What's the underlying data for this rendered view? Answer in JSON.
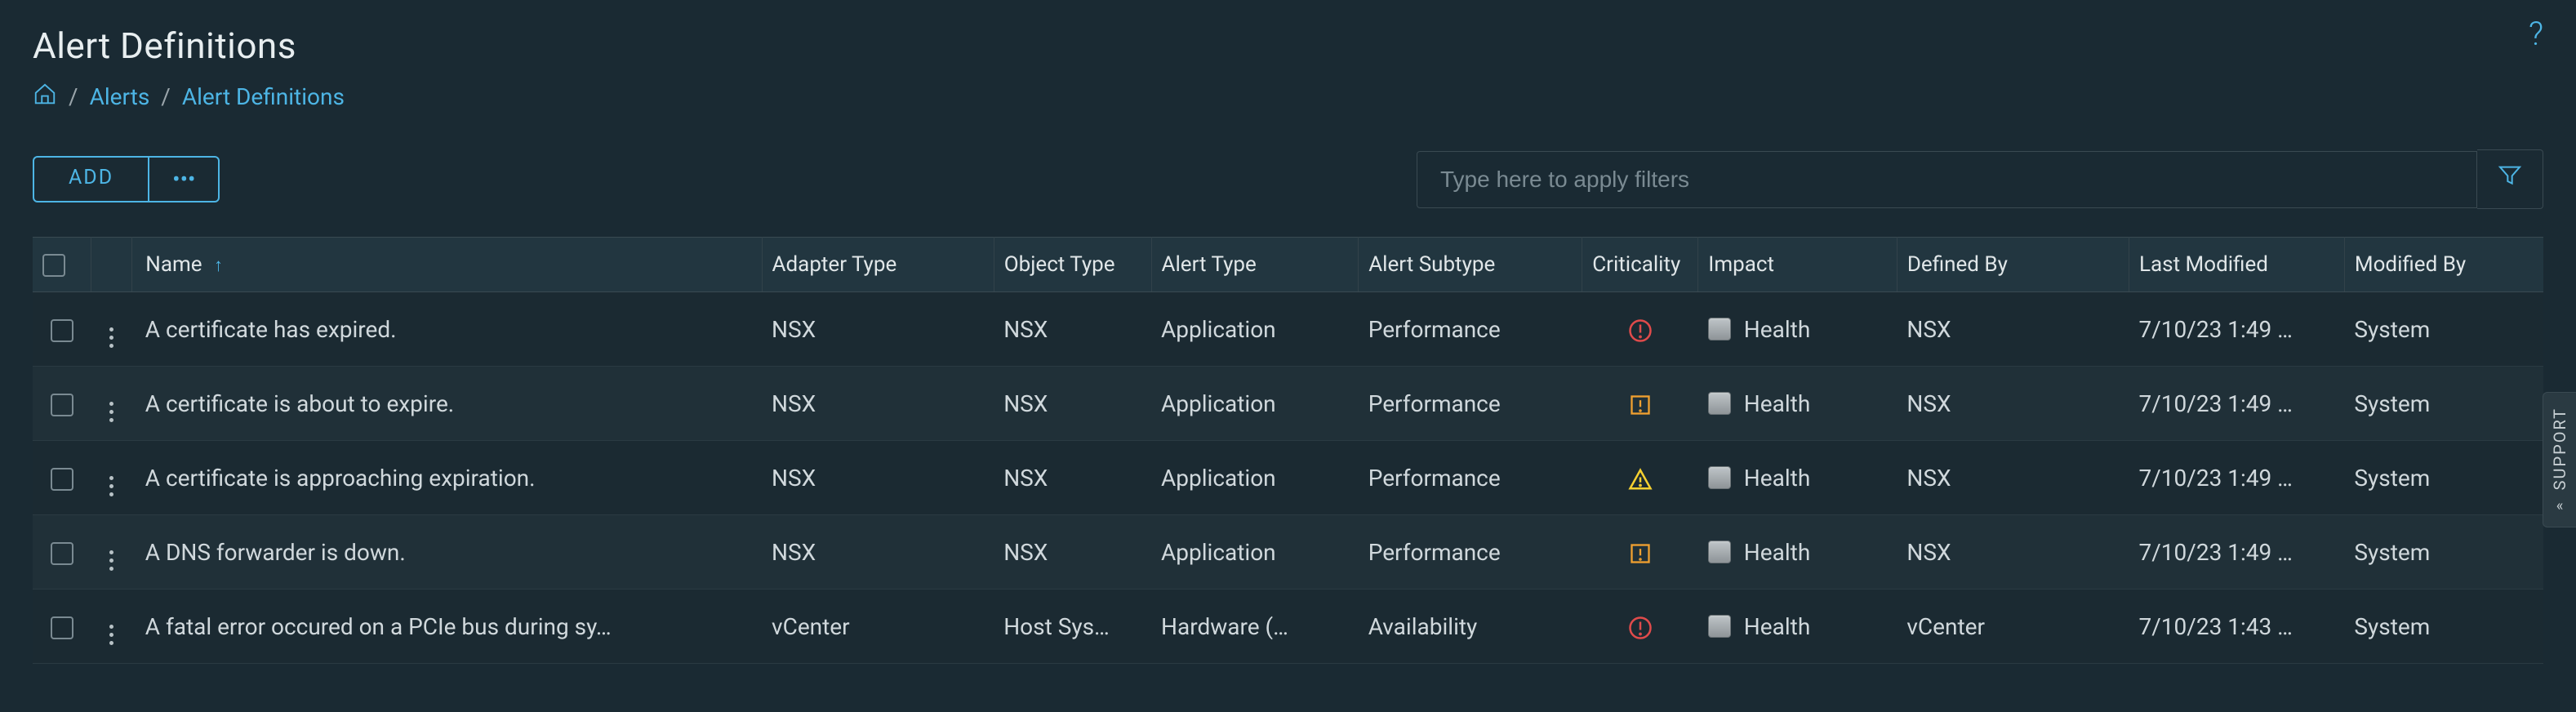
{
  "page_title": "Alert Definitions",
  "breadcrumb": {
    "alerts": "Alerts",
    "current": "Alert Definitions"
  },
  "toolbar": {
    "add_label": "ADD",
    "more_label": "•••"
  },
  "filter": {
    "placeholder": "Type here to apply filters"
  },
  "columns": {
    "name": "Name",
    "adapter_type": "Adapter Type",
    "object_type": "Object Type",
    "alert_type": "Alert Type",
    "alert_subtype": "Alert Subtype",
    "criticality": "Criticality",
    "impact": "Impact",
    "defined_by": "Defined By",
    "last_modified": "Last Modified",
    "modified_by": "Modified By"
  },
  "rows": [
    {
      "name": "A certificate has expired.",
      "adapter_type": "NSX",
      "object_type": "NSX",
      "alert_type": "Application",
      "alert_subtype": "Performance",
      "criticality": "critical",
      "impact": "Health",
      "defined_by": "NSX",
      "last_modified": "7/10/23 1:49 …",
      "modified_by": "System"
    },
    {
      "name": "A certificate is about to expire.",
      "adapter_type": "NSX",
      "object_type": "NSX",
      "alert_type": "Application",
      "alert_subtype": "Performance",
      "criticality": "immediate",
      "impact": "Health",
      "defined_by": "NSX",
      "last_modified": "7/10/23 1:49 …",
      "modified_by": "System"
    },
    {
      "name": "A certificate is approaching expiration.",
      "adapter_type": "NSX",
      "object_type": "NSX",
      "alert_type": "Application",
      "alert_subtype": "Performance",
      "criticality": "warning",
      "impact": "Health",
      "defined_by": "NSX",
      "last_modified": "7/10/23 1:49 …",
      "modified_by": "System"
    },
    {
      "name": "A DNS forwarder is down.",
      "adapter_type": "NSX",
      "object_type": "NSX",
      "alert_type": "Application",
      "alert_subtype": "Performance",
      "criticality": "immediate",
      "impact": "Health",
      "defined_by": "NSX",
      "last_modified": "7/10/23 1:49 …",
      "modified_by": "System"
    },
    {
      "name": "A fatal error occured on a PCIe bus during sy…",
      "adapter_type": "vCenter",
      "object_type": "Host Sys…",
      "alert_type": "Hardware (…",
      "alert_subtype": "Availability",
      "criticality": "critical",
      "impact": "Health",
      "defined_by": "vCenter",
      "last_modified": "7/10/23 1:43 …",
      "modified_by": "System"
    }
  ],
  "support": {
    "label": "SUPPORT"
  },
  "colors": {
    "accent": "#4db5e5",
    "critical": "#e04b4b",
    "immediate": "#f0a030",
    "warning": "#f5d030"
  }
}
